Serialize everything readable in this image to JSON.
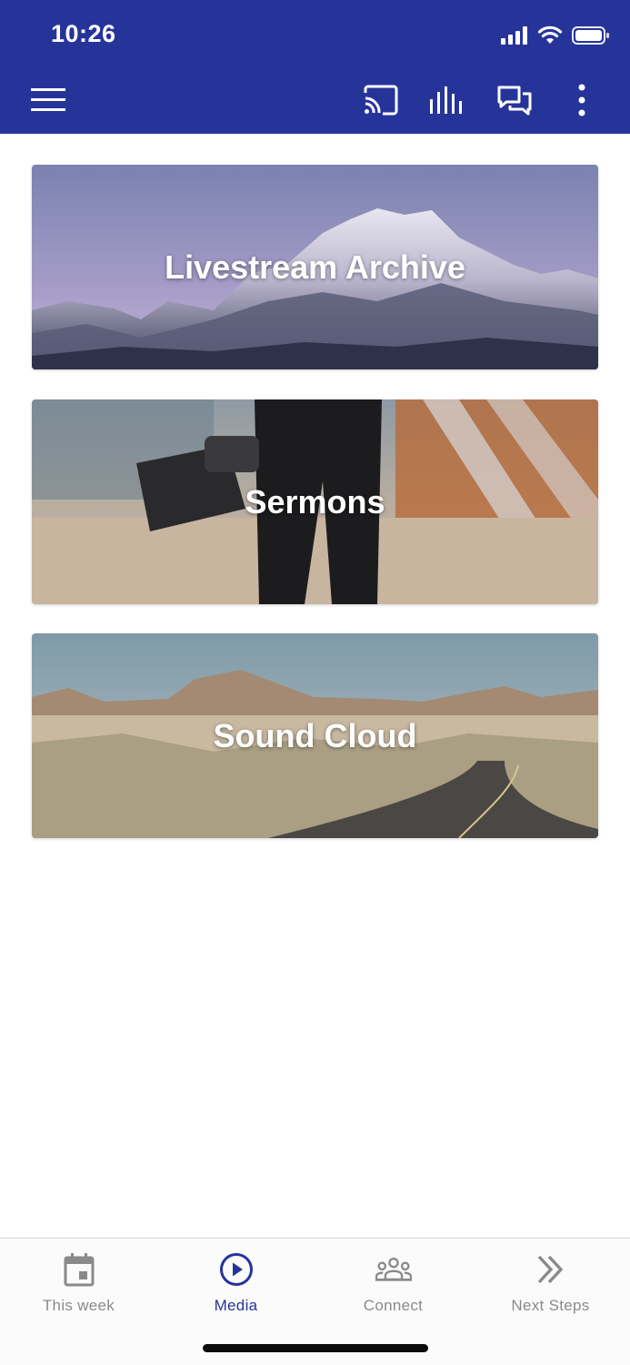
{
  "status_bar": {
    "time": "10:26"
  },
  "toolbar": {
    "menu_icon": "hamburger-menu-icon",
    "actions": [
      "cast-icon",
      "audio-bars-icon",
      "chat-icon",
      "more-vertical-icon"
    ]
  },
  "cards": [
    {
      "title": "Livestream Archive",
      "image": "snowy-mountain-range"
    },
    {
      "title": "Sermons",
      "image": "person-holding-camera"
    },
    {
      "title": "Sound Cloud",
      "image": "desert-road"
    }
  ],
  "bottom_nav": {
    "items": [
      {
        "label": "This week",
        "icon": "calendar-icon",
        "active": false
      },
      {
        "label": "Media",
        "icon": "play-circle-icon",
        "active": true
      },
      {
        "label": "Connect",
        "icon": "group-icon",
        "active": false
      },
      {
        "label": "Next Steps",
        "icon": "double-chevron-right-icon",
        "active": false
      }
    ]
  },
  "colors": {
    "primary": "#26349a",
    "inactive": "#8a8a8a",
    "background": "#ffffff"
  }
}
